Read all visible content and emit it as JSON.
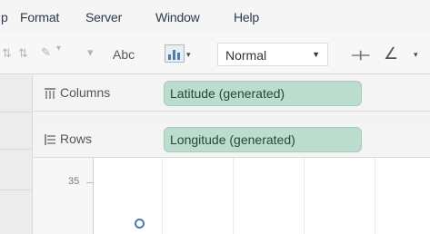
{
  "menu": {
    "items": [
      "p",
      "Format",
      "Server",
      "Window",
      "Help"
    ]
  },
  "toolbar": {
    "text_label": "Abc",
    "fit_select": {
      "value": "Normal"
    },
    "icons": [
      "text-color-icon",
      "line-color-icon",
      "show-me-icon",
      "fit-width-icon",
      "annotate-pen-icon"
    ]
  },
  "shelves": {
    "columns": {
      "label": "Columns",
      "pill": "Latitude (generated)"
    },
    "rows": {
      "label": "Rows",
      "pill": "Longitude (generated)"
    }
  },
  "chart_data": {
    "type": "scatter",
    "y_ticks": [
      "35"
    ],
    "mark_shape": "open-circle",
    "mark_color": "#4e79a7"
  },
  "colors": {
    "pill_bg": "#bcdccd",
    "mark": "#4e79a7"
  }
}
